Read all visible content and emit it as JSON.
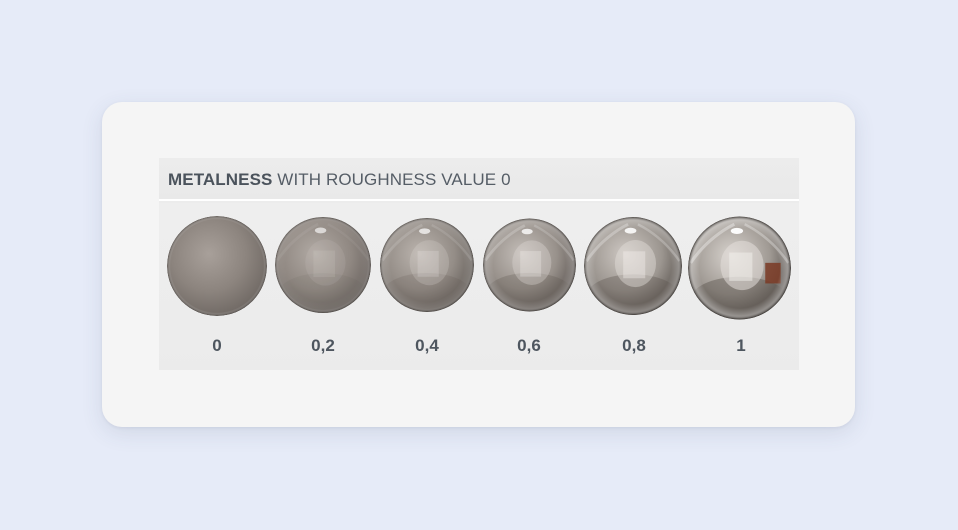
{
  "figure": {
    "title_bold": "METALNESS",
    "title_rest": " WITH ROUGHNESS VALUE 0"
  },
  "spheres": [
    {
      "label": "0",
      "metalness": 0
    },
    {
      "label": "0,2",
      "metalness": 0.2
    },
    {
      "label": "0,4",
      "metalness": 0.4
    },
    {
      "label": "0,6",
      "metalness": 0.6
    },
    {
      "label": "0,8",
      "metalness": 0.8
    },
    {
      "label": "1",
      "metalness": 1
    }
  ],
  "colors": {
    "page_background": "#e6ebf8",
    "card_background": "#f5f5f5",
    "figure_background": "#ececec",
    "label_text": "#4e565f"
  }
}
